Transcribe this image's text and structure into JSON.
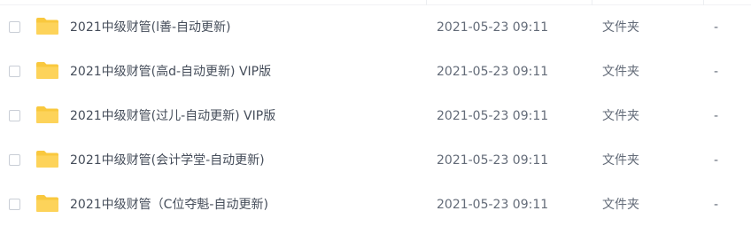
{
  "folder_icon_color": "#f9c83e",
  "files": [
    {
      "name": "2021中级财管(l善-自动更新)",
      "modified": "2021-05-23 09:11",
      "type": "文件夹",
      "size": "-"
    },
    {
      "name": "2021中级财管(高d-自动更新) VIP版",
      "modified": "2021-05-23 09:11",
      "type": "文件夹",
      "size": "-"
    },
    {
      "name": "2021中级财管(过儿-自动更新) VIP版",
      "modified": "2021-05-23 09:11",
      "type": "文件夹",
      "size": "-"
    },
    {
      "name": "2021中级财管(会计学堂-自动更新)",
      "modified": "2021-05-23 09:11",
      "type": "文件夹",
      "size": "-"
    },
    {
      "name": "2021中级财管（C位夺魁-自动更新)",
      "modified": "2021-05-23 09:11",
      "type": "文件夹",
      "size": "-"
    }
  ]
}
